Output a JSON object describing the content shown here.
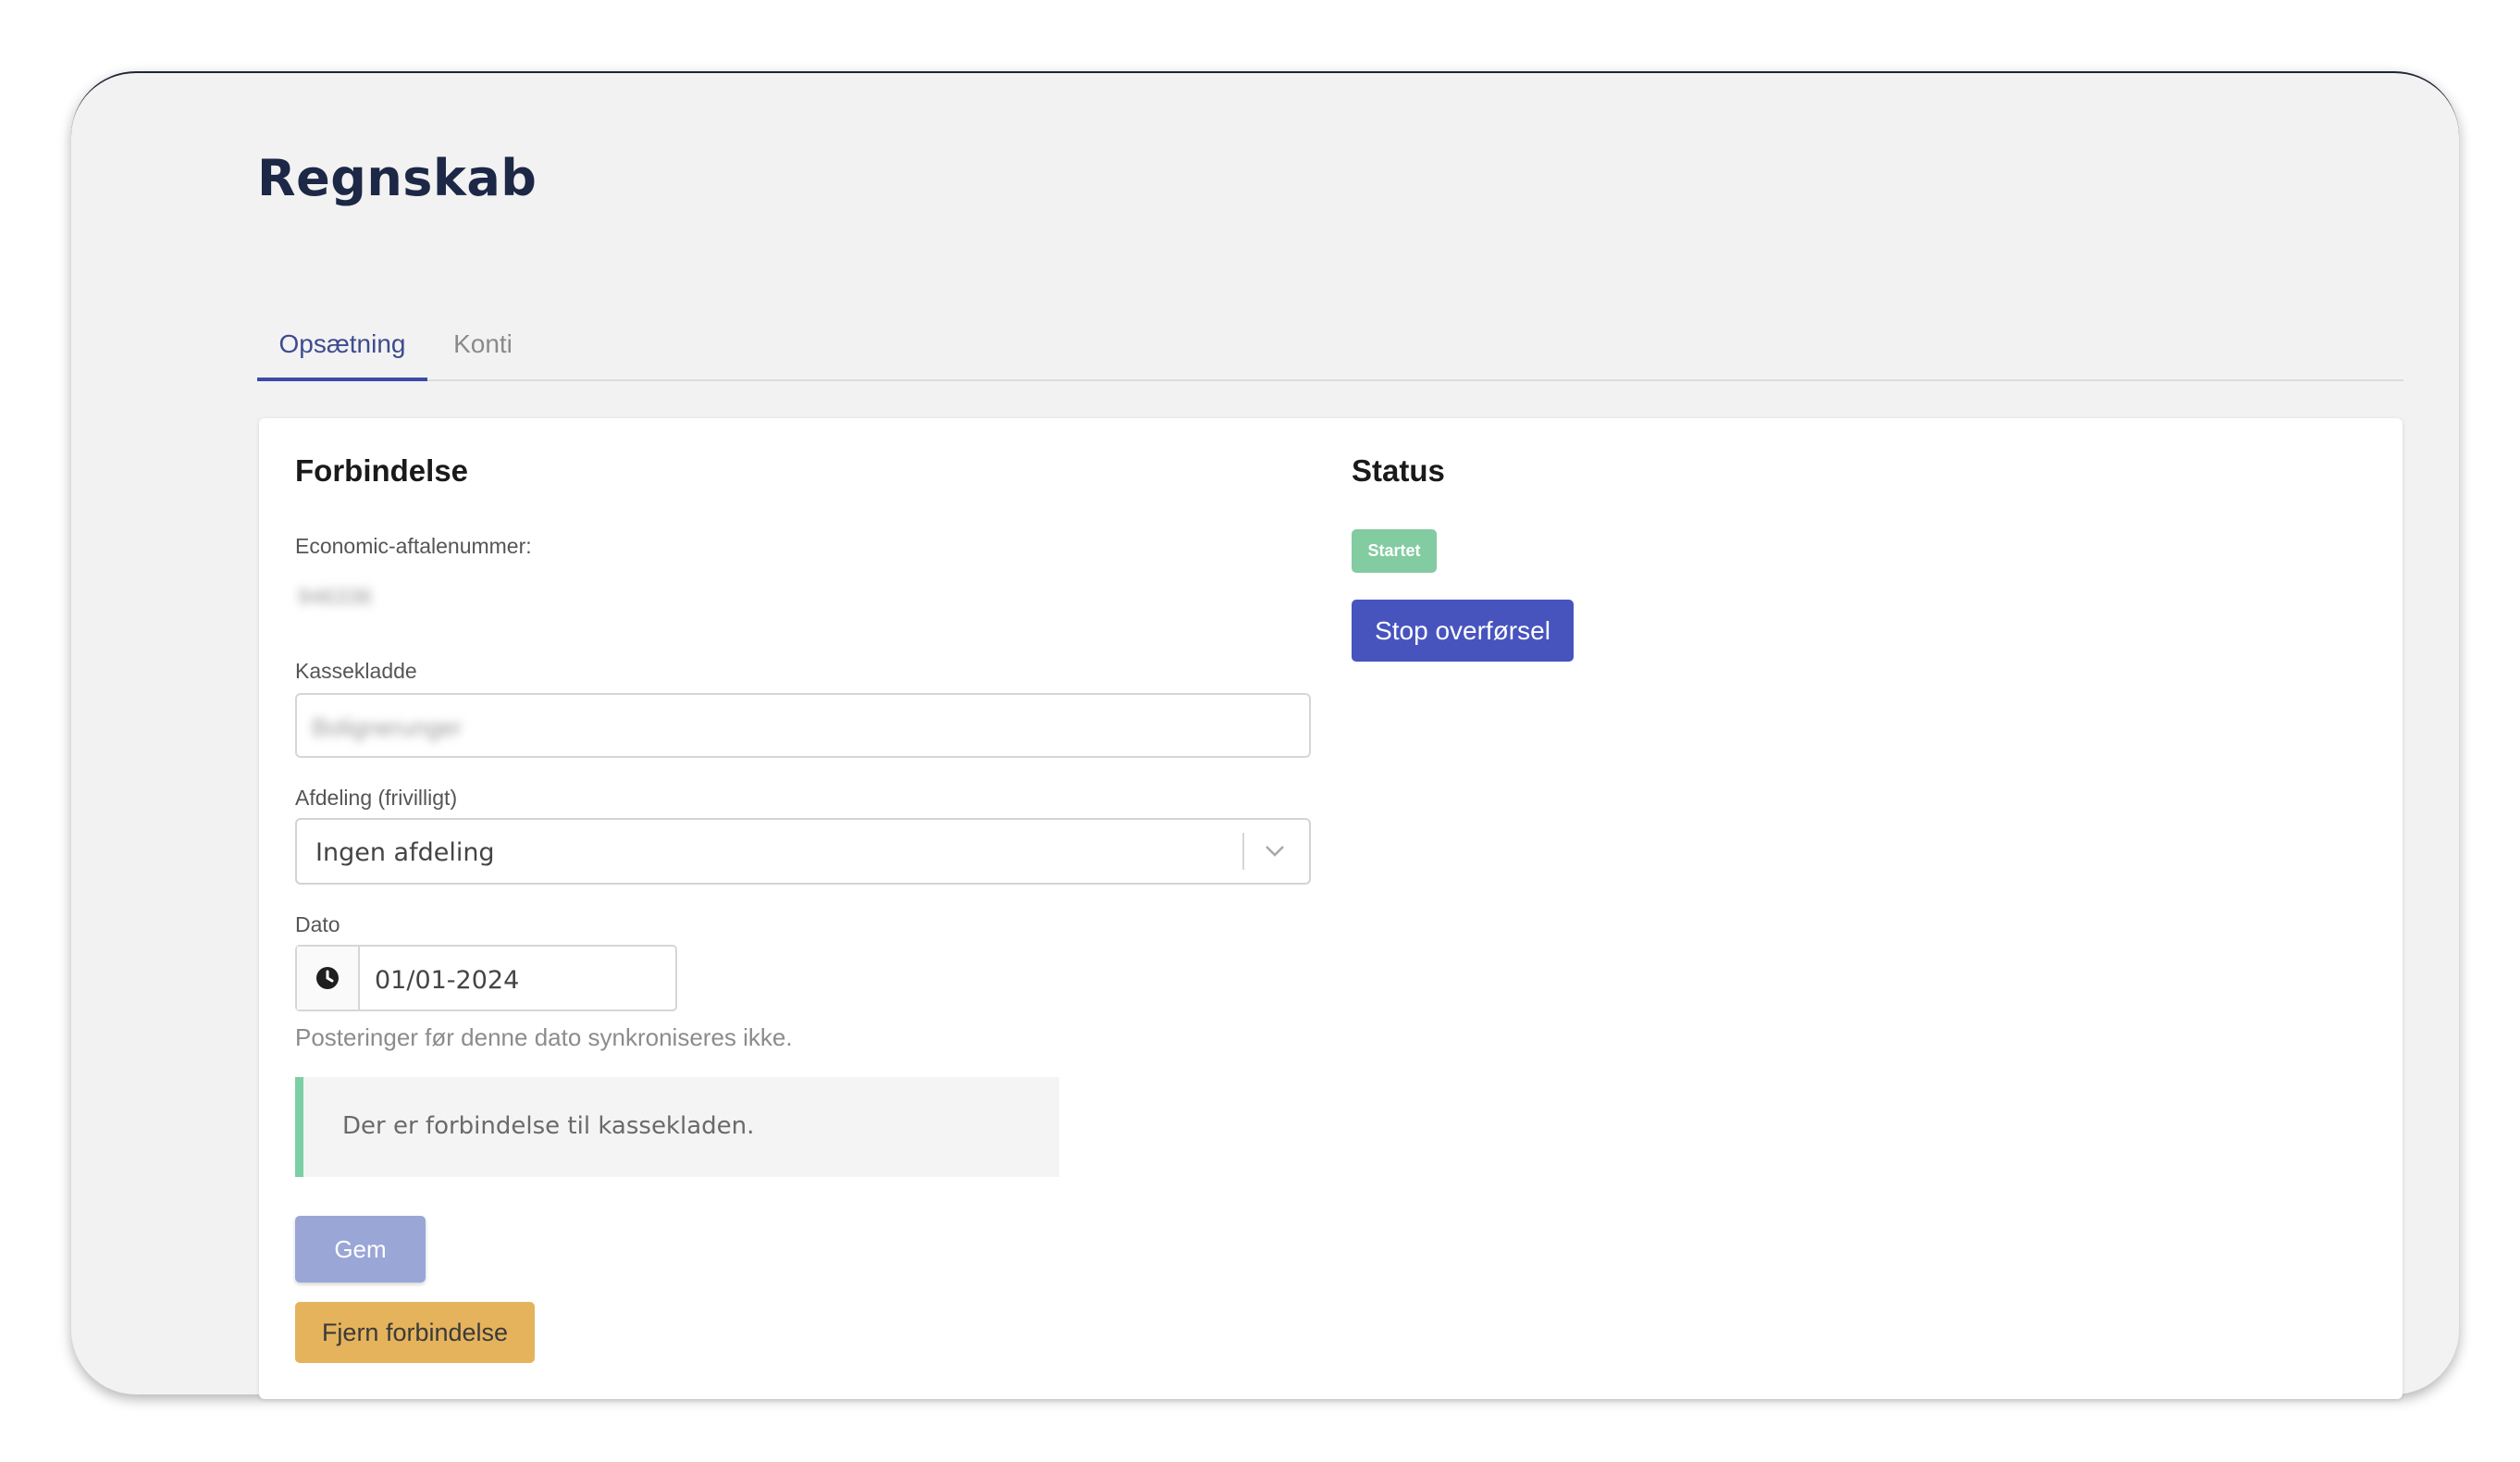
{
  "page": {
    "title": "Regnskab"
  },
  "tabs": [
    {
      "label": "Opsætning",
      "active": true
    },
    {
      "label": "Konti",
      "active": false
    }
  ],
  "connection": {
    "title": "Forbindelse",
    "agreement_label": "Economic-aftalenummer:",
    "agreement_value": "946336",
    "journal_label": "Kassekladde",
    "journal_value": "Bolignerunger",
    "department_label": "Afdeling (frivilligt)",
    "department_value": "Ingen afdeling",
    "date_label": "Dato",
    "date_value": "01/01-2024",
    "date_help": "Posteringer før denne dato synkroniseres ikke.",
    "notice": "Der er forbindelse til kassekladen.",
    "save_label": "Gem",
    "remove_label": "Fjern forbindelse"
  },
  "status": {
    "title": "Status",
    "badge": "Startet",
    "stop_label": "Stop overførsel"
  },
  "colors": {
    "accent": "#4754be",
    "success": "#83cba0",
    "warning": "#e4b35c",
    "title": "#1d2746"
  }
}
